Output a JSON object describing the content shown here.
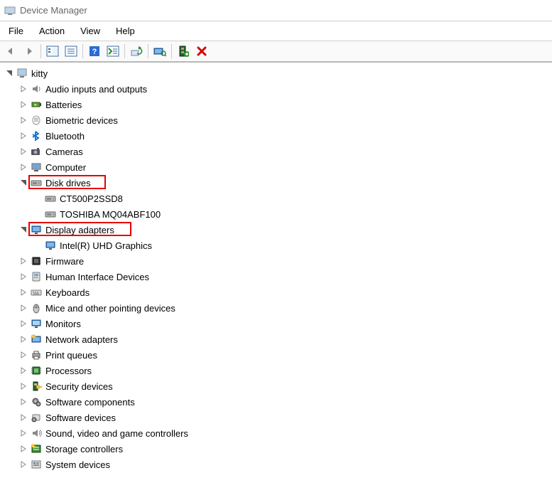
{
  "window": {
    "title": "Device Manager"
  },
  "menubar": [
    "File",
    "Action",
    "View",
    "Help"
  ],
  "tree": {
    "root": "kitty",
    "nodes": [
      {
        "label": "Audio inputs and outputs",
        "icon": "speaker",
        "expanded": false,
        "children": []
      },
      {
        "label": "Batteries",
        "icon": "battery",
        "expanded": false,
        "children": []
      },
      {
        "label": "Biometric devices",
        "icon": "biometric",
        "expanded": false,
        "children": []
      },
      {
        "label": "Bluetooth",
        "icon": "bluetooth",
        "expanded": false,
        "children": []
      },
      {
        "label": "Cameras",
        "icon": "camera",
        "expanded": false,
        "children": []
      },
      {
        "label": "Computer",
        "icon": "computer",
        "expanded": false,
        "children": []
      },
      {
        "label": "Disk drives",
        "icon": "disk",
        "expanded": true,
        "highlight": true,
        "children": [
          {
            "label": "CT500P2SSD8",
            "icon": "disk"
          },
          {
            "label": "TOSHIBA MQ04ABF100",
            "icon": "disk"
          }
        ]
      },
      {
        "label": "Display adapters",
        "icon": "display",
        "expanded": true,
        "highlight": true,
        "children": [
          {
            "label": "Intel(R) UHD Graphics",
            "icon": "display"
          }
        ]
      },
      {
        "label": "Firmware",
        "icon": "firmware",
        "expanded": false,
        "children": []
      },
      {
        "label": "Human Interface Devices",
        "icon": "hid",
        "expanded": false,
        "children": []
      },
      {
        "label": "Keyboards",
        "icon": "keyboard",
        "expanded": false,
        "children": []
      },
      {
        "label": "Mice and other pointing devices",
        "icon": "mouse",
        "expanded": false,
        "children": []
      },
      {
        "label": "Monitors",
        "icon": "monitor",
        "expanded": false,
        "children": []
      },
      {
        "label": "Network adapters",
        "icon": "network",
        "expanded": false,
        "children": []
      },
      {
        "label": "Print queues",
        "icon": "printer",
        "expanded": false,
        "children": []
      },
      {
        "label": "Processors",
        "icon": "cpu",
        "expanded": false,
        "children": []
      },
      {
        "label": "Security devices",
        "icon": "security",
        "expanded": false,
        "children": []
      },
      {
        "label": "Software components",
        "icon": "swcomp",
        "expanded": false,
        "children": []
      },
      {
        "label": "Software devices",
        "icon": "swdev",
        "expanded": false,
        "children": []
      },
      {
        "label": "Sound, video and game controllers",
        "icon": "sound",
        "expanded": false,
        "children": []
      },
      {
        "label": "Storage controllers",
        "icon": "storage",
        "expanded": false,
        "children": []
      },
      {
        "label": "System devices",
        "icon": "system",
        "expanded": false,
        "children": []
      }
    ]
  }
}
